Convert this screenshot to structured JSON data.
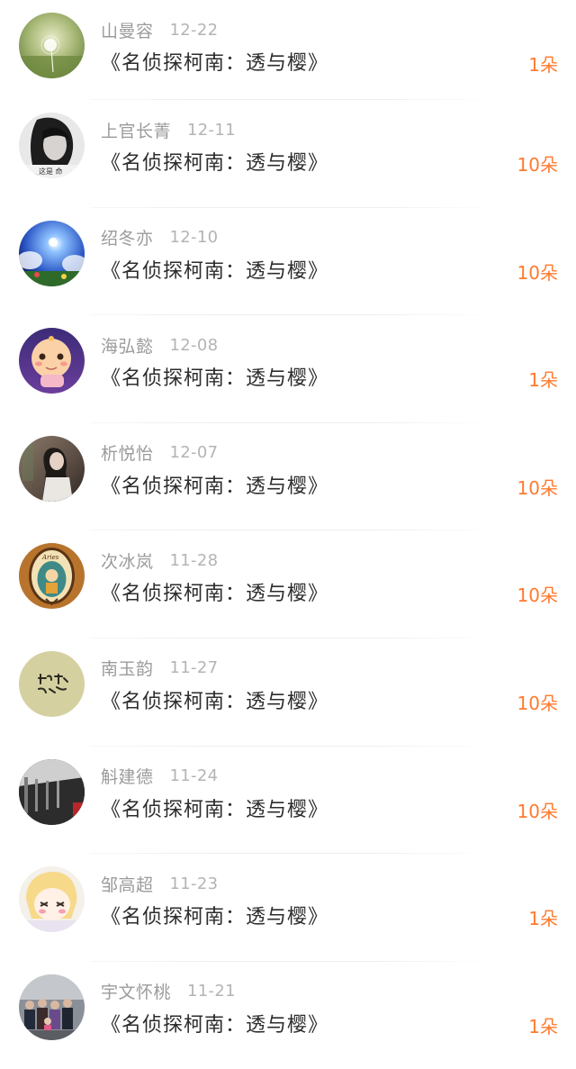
{
  "items": [
    {
      "name": "山曼容",
      "date": "12-22",
      "title": "《名侦探柯南：透与樱》",
      "amount": "1朵",
      "avatar_icon": "dandelion-avatar-icon"
    },
    {
      "name": "上官长菁",
      "date": "12-11",
      "title": "《名侦探柯南：透与樱》",
      "amount": "10朵",
      "avatar_icon": "girl-portrait-avatar-icon"
    },
    {
      "name": "绍冬亦",
      "date": "12-10",
      "title": "《名侦探柯南：透与樱》",
      "amount": "10朵",
      "avatar_icon": "sky-planet-avatar-icon"
    },
    {
      "name": "海弘懿",
      "date": "12-08",
      "title": "《名侦探柯南：透与樱》",
      "amount": "1朵",
      "avatar_icon": "baby-cartoon-avatar-icon"
    },
    {
      "name": "析悦怡",
      "date": "12-07",
      "title": "《名侦探柯南：透与樱》",
      "amount": "10朵",
      "avatar_icon": "woman-photo-avatar-icon"
    },
    {
      "name": "次冰岚",
      "date": "11-28",
      "title": "《名侦探柯南：透与樱》",
      "amount": "10朵",
      "avatar_icon": "zodiac-badge-avatar-icon"
    },
    {
      "name": "南玉韵",
      "date": "11-27",
      "title": "《名侦探柯南：透与樱》",
      "amount": "10朵",
      "avatar_icon": "calligraphy-avatar-icon"
    },
    {
      "name": "斛建德",
      "date": "11-24",
      "title": "《名侦探柯南：透与樱》",
      "amount": "10朵",
      "avatar_icon": "street-photo-avatar-icon"
    },
    {
      "name": "邹高超",
      "date": "11-23",
      "title": "《名侦探柯南：透与樱》",
      "amount": "1朵",
      "avatar_icon": "anime-girl-avatar-icon"
    },
    {
      "name": "宇文怀桃",
      "date": "11-21",
      "title": "《名侦探柯南：透与樱》",
      "amount": "1朵",
      "avatar_icon": "group-photo-avatar-icon"
    }
  ],
  "colors": {
    "accent": "#ff7a2f",
    "name_text": "#9b9b9b",
    "date_text": "#b4b4b4",
    "title_text": "#2c2c2c",
    "divider": "#eeeeee"
  }
}
